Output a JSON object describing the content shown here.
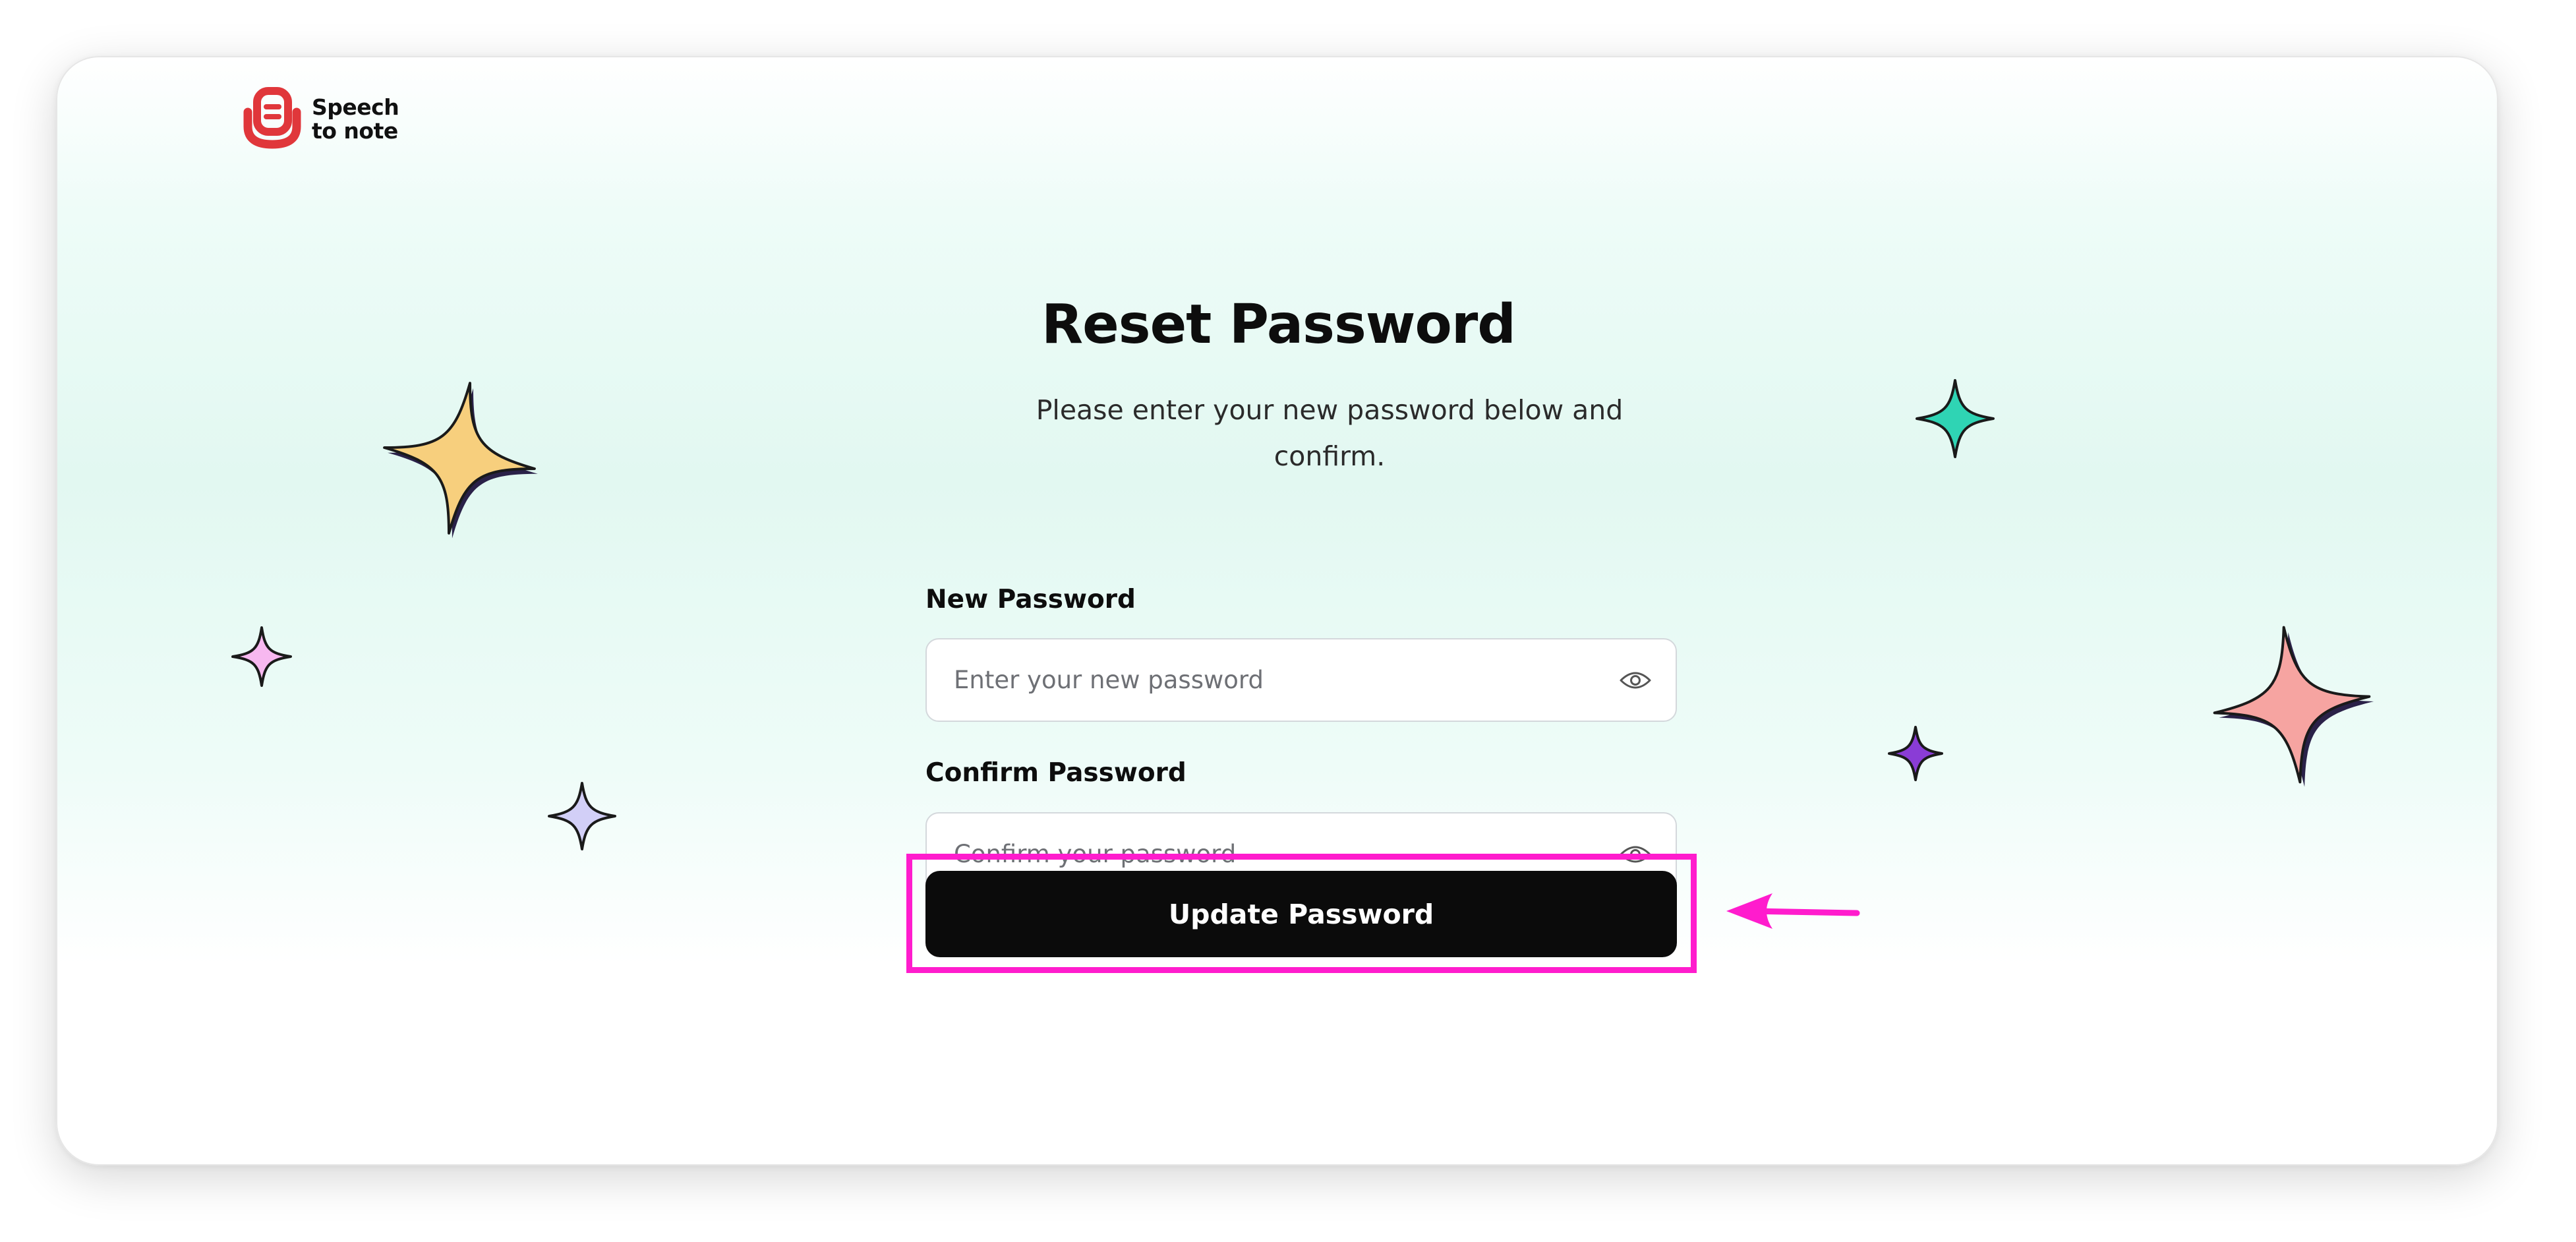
{
  "brand": {
    "name_line1": "Speech",
    "name_line2": "to note",
    "logo_icon": "speech-to-note-logo-icon",
    "logo_color": "#e0373b"
  },
  "page": {
    "title": "Reset Password",
    "subtitle": "Please enter your new password below and confirm."
  },
  "form": {
    "new_password": {
      "label": "New Password",
      "placeholder": "Enter your new password",
      "value": "",
      "toggle_icon": "eye-icon"
    },
    "confirm_password": {
      "label": "Confirm Password",
      "placeholder": "Confirm your password",
      "value": "",
      "toggle_icon": "eye-icon"
    },
    "submit_label": "Update Password"
  },
  "annotation": {
    "highlight_color": "#ff1ccd",
    "arrow_icon": "pointer-arrow-icon"
  },
  "decorations": {
    "sparkle_colors": {
      "yellow": "#f7cf7d",
      "pink_small": "#f7b8f0",
      "lavender": "#d2cff7",
      "teal": "#2fd4b4",
      "purple": "#8a3cd6",
      "coral": "#f6a4a1"
    }
  },
  "colors": {
    "button_bg": "#0b0b0b",
    "background_tint": "#e2f8f1"
  }
}
